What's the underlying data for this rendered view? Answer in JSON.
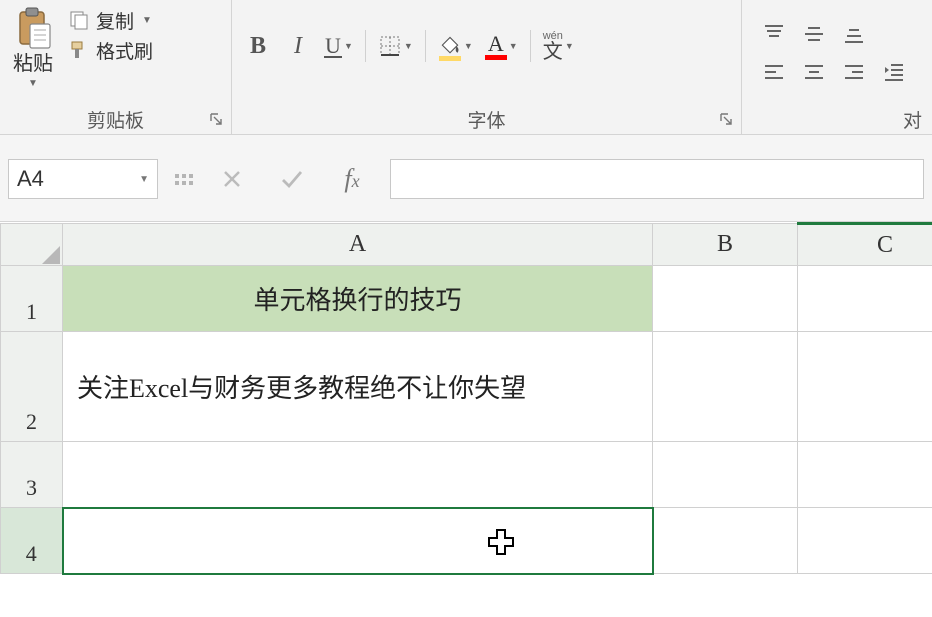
{
  "ribbon": {
    "clipboard": {
      "label": "剪贴板",
      "paste": "粘贴",
      "copy": "复制",
      "format_painter": "格式刷"
    },
    "font": {
      "label": "字体",
      "bold": "B",
      "italic": "I",
      "underline": "U",
      "pinyin": "wén",
      "pinyin_char": "文",
      "font_color_letter": "A",
      "fill_color_hex": "#ffd966",
      "font_color_hex": "#ff0000"
    },
    "alignment": {
      "label": "对"
    }
  },
  "formula_bar": {
    "name_box": "A4",
    "fx_label": "fx",
    "value": ""
  },
  "sheet": {
    "columns": [
      "A",
      "B",
      "C"
    ],
    "rows": [
      "1",
      "2",
      "3",
      "4"
    ],
    "cells": {
      "A1": "单元格换行的技巧",
      "A2": "关注Excel与财务更多教程绝不让你失望",
      "A3": "",
      "A4": ""
    },
    "active_cell": "A4"
  }
}
